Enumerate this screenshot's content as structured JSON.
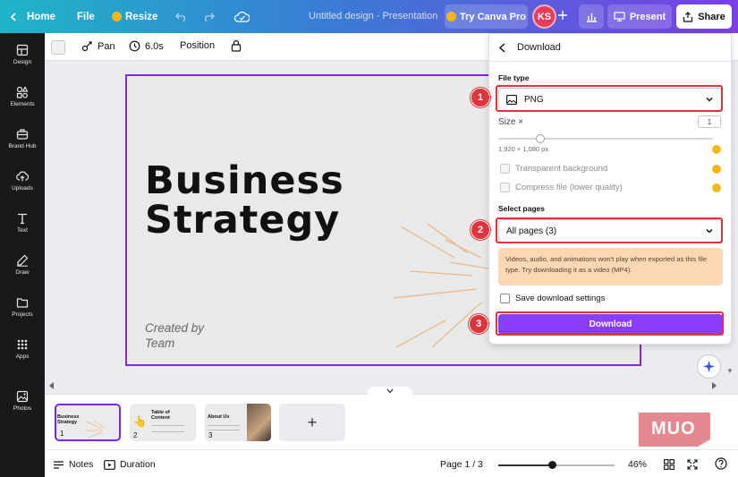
{
  "topbar": {
    "home_label": "Home",
    "file_label": "File",
    "resize_label": "Resize",
    "doc_title": "Untitled design - Presentation",
    "try_pro_label": "Try Canva Pro",
    "avatar_initials": "KS",
    "present_label": "Present",
    "share_label": "Share"
  },
  "sidebar": {
    "items": [
      {
        "label": "Design",
        "icon": "layout-icon"
      },
      {
        "label": "Elements",
        "icon": "shapes-icon"
      },
      {
        "label": "Brand Hub",
        "icon": "briefcase-icon"
      },
      {
        "label": "Uploads",
        "icon": "cloud-upload-icon"
      },
      {
        "label": "Text",
        "icon": "text-icon"
      },
      {
        "label": "Draw",
        "icon": "pen-icon"
      },
      {
        "label": "Projects",
        "icon": "folder-icon"
      },
      {
        "label": "Apps",
        "icon": "grid-icon"
      },
      {
        "label": "Photos",
        "icon": "image-icon"
      }
    ]
  },
  "subbar": {
    "pan_label": "Pan",
    "duration_label": "6.0s",
    "position_label": "Position"
  },
  "slide": {
    "title_line1": "Business",
    "title_line2": "Strategy",
    "sub_line1": "Created by",
    "sub_line2": "Team"
  },
  "download_panel": {
    "header": "Download",
    "file_type_label": "File type",
    "file_type_value": "PNG",
    "size_label": "Size ×",
    "size_value": "1",
    "size_level": 0.2,
    "dimensions": "1,920 × 1,080 px",
    "transparent_label": "Transparent background",
    "compress_label": "Compress file (lower quality)",
    "select_pages_label": "Select pages",
    "pages_value": "All pages (3)",
    "warning": "Videos, audio, and animations won't play when exported as this file type. Try downloading it as a video (MP4).",
    "save_settings_label": "Save download settings",
    "download_button": "Download",
    "step_badges": [
      "1",
      "2",
      "3"
    ]
  },
  "pages": {
    "thumbs": [
      {
        "num": "1",
        "title": "Business Strategy"
      },
      {
        "num": "2",
        "title": "Table of Content"
      },
      {
        "num": "3",
        "title": "About Us"
      }
    ],
    "add_label": "+"
  },
  "footer": {
    "notes_label": "Notes",
    "duration_label": "Duration",
    "page_indicator": "Page 1 / 3",
    "zoom_label": "46%",
    "zoom_level": 0.46
  },
  "watermark": {
    "text": "MUO"
  },
  "colors": {
    "accent": "#8b3dff",
    "highlight": "#e0343c",
    "warning_bg": "#fbd8b3",
    "sidebar_bg": "#18191b"
  }
}
